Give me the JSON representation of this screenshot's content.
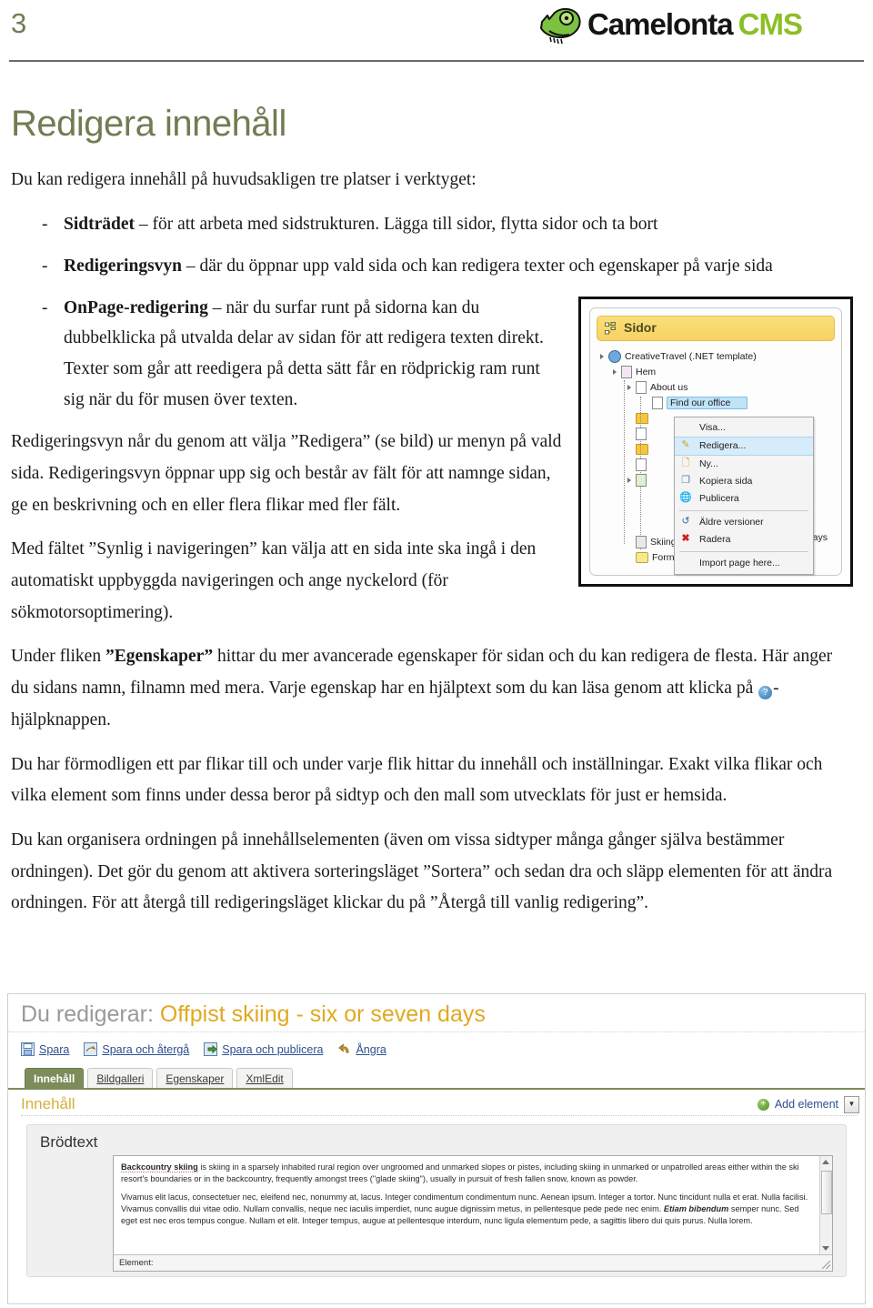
{
  "header": {
    "page_number": "3",
    "logo_name": "Camelonta",
    "logo_suffix": "CMS"
  },
  "doc": {
    "title": "Redigera innehåll",
    "intro": "Du kan redigera innehåll på huvudsakligen tre platser i verktyget:",
    "bullets": [
      {
        "dash": "-",
        "term": "Sidträdet",
        "text": " – för att arbeta med sidstrukturen. Lägga till sidor, flytta sidor och ta bort"
      },
      {
        "dash": "-",
        "term": "Redigeringsvyn",
        "text": " – där du öppnar upp vald sida och kan redigera texter och egenskaper på varje sida"
      },
      {
        "dash": "-",
        "term": "OnPage-redigering",
        "text": " – när du surfar runt på sidorna kan du dubbelklicka på utvalda delar av sidan för att redigera texten direkt. Texter som går att reedigera på detta sätt får en rödprickig ram runt sig när du för musen över texten."
      }
    ],
    "para_edit_view": "Redigeringsvyn når du genom att välja ”Redigera” (se bild) ur menyn på vald sida. Redigeringsvyn öppnar upp sig och består av fält för att namnge sidan, ge en beskrivning och en eller flera flikar med fler fält.",
    "para_nav_field": "Med fältet ”Synlig i navigeringen” kan välja att en sida inte ska ingå i den automatiskt uppbyggda navigeringen och ange nyckelord (för sökmotorsoptimering).",
    "para_props_1": "Under fliken ",
    "para_props_term": "”Egenskaper”",
    "para_props_2": " hittar du mer avancerade egenskaper för sidan och du kan redigera de flesta. Här anger du sidans namn, filnamn med mera. Varje egenskap har en hjälptext som du kan läsa genom att klicka på ",
    "para_props_3": "-hjälpknappen.",
    "para_tabs": "Du har förmodligen ett par flikar till och under varje flik hittar du innehåll och inställningar. Exakt vilka flikar och vilka element som finns under dessa beror på sidtyp och den mall som utvecklats för just er hemsida.",
    "para_sort": "Du kan organisera ordningen på innehållselementen (även om vissa sidtyper många gånger själva bestämmer ordningen). Det gör du genom att aktivera sorteringsläget ”Sortera” och sedan dra och släpp elementen för att ändra ordningen. För att återgå till redigeringsläget klickar du på ”Återgå till vanlig redigering”."
  },
  "sidor_panel": {
    "title": "Sidor",
    "tree": [
      {
        "label": "CreativeTravel (.NET template)",
        "icon": "globe-icon",
        "indent": 0,
        "expanded": true
      },
      {
        "label": "Hem",
        "icon": "page-pink-icon",
        "indent": 1,
        "expanded": true
      },
      {
        "label": "About us",
        "icon": "page-icon",
        "indent": 2,
        "expanded": true
      },
      {
        "label": "Find our office",
        "icon": "page-icon",
        "indent": 3,
        "selected": true
      },
      {
        "label": "Skiing pictures",
        "icon": "page-grey-icon",
        "indent": 2
      },
      {
        "label": "Formulär - Kontakta oss",
        "icon": "form-icon",
        "indent": 2
      }
    ],
    "context_menu": [
      {
        "label": "Visa...",
        "icon": "none",
        "highlighted": false
      },
      {
        "label": "Redigera...",
        "icon": "pencil-icon",
        "highlighted": true
      },
      {
        "label": "Ny...",
        "icon": "new-page-icon",
        "highlighted": false
      },
      {
        "label": "Kopiera sida",
        "icon": "copy-icon",
        "highlighted": false
      },
      {
        "label": "Publicera",
        "icon": "publish-globe-icon",
        "highlighted": false
      },
      {
        "label": "Äldre versioner",
        "icon": "history-icon",
        "highlighted": false
      },
      {
        "label": "Radera",
        "icon": "delete-x-icon",
        "highlighted": false
      },
      {
        "label": "Import page here...",
        "icon": "none",
        "highlighted": false
      }
    ],
    "occluded_text": "ays"
  },
  "editor": {
    "title_prefix": "Du redigerar:",
    "page_name": "Offpist skiing - six or seven days",
    "toolbar": [
      {
        "label": "Spara",
        "icon": "save-disk-icon"
      },
      {
        "label": "Spara och återgå",
        "icon": "save-return-icon"
      },
      {
        "label": "Spara och publicera",
        "icon": "save-publish-icon"
      },
      {
        "label": "Ångra",
        "icon": "undo-icon"
      }
    ],
    "tabs": [
      {
        "label": "Innehåll",
        "active": true
      },
      {
        "label": "Bildgalleri",
        "active": false
      },
      {
        "label": "Egenskaper",
        "active": false
      },
      {
        "label": "XmlEdit",
        "active": false
      }
    ],
    "section_title": "Innehåll",
    "add_element_label": "Add element",
    "panel_title": "Brödtext",
    "textarea": {
      "paragraph_1_bold": "Backcountry skiing",
      "paragraph_1": " is skiing in a sparsely inhabited rural region over ungroomed and unmarked slopes or pistes, including skiing in unmarked or unpatrolled areas either within the ski resort's boundaries or in the backcountry, frequently amongst trees (\"glade skiing\"), usually in pursuit of fresh fallen snow, known as powder.",
      "paragraph_2_a": "Vivamus elit lacus, consectetuer nec, eleifend nec, nonummy at, lacus. Integer condimentum condimentum nunc. Aenean ipsum. Integer a tortor. Nunc tincidunt nulla et erat. Nulla facilisi. Vivamus convallis dui vitae odio. Nullam convallis, neque nec iaculis imperdiet, nunc augue dignissim metus, in pellentesque pede pede nec enim. ",
      "paragraph_2_bold": "Etiam bibendum",
      "paragraph_2_b": " semper nunc. Sed eget est nec eros tempus congue. Nullam et elit. Integer tempus, augue at pellentesque interdum, nunc ligula elementum pede, a sagittis libero dui quis purus. Nulla lorem."
    },
    "status_label": "Element:"
  },
  "colors": {
    "accent_green": "#6f7d52",
    "logo_green": "#8cbf27",
    "title_gold": "#e0a921",
    "tab_active_bg": "#7c8c5b",
    "link_blue": "#2d4f8e"
  }
}
